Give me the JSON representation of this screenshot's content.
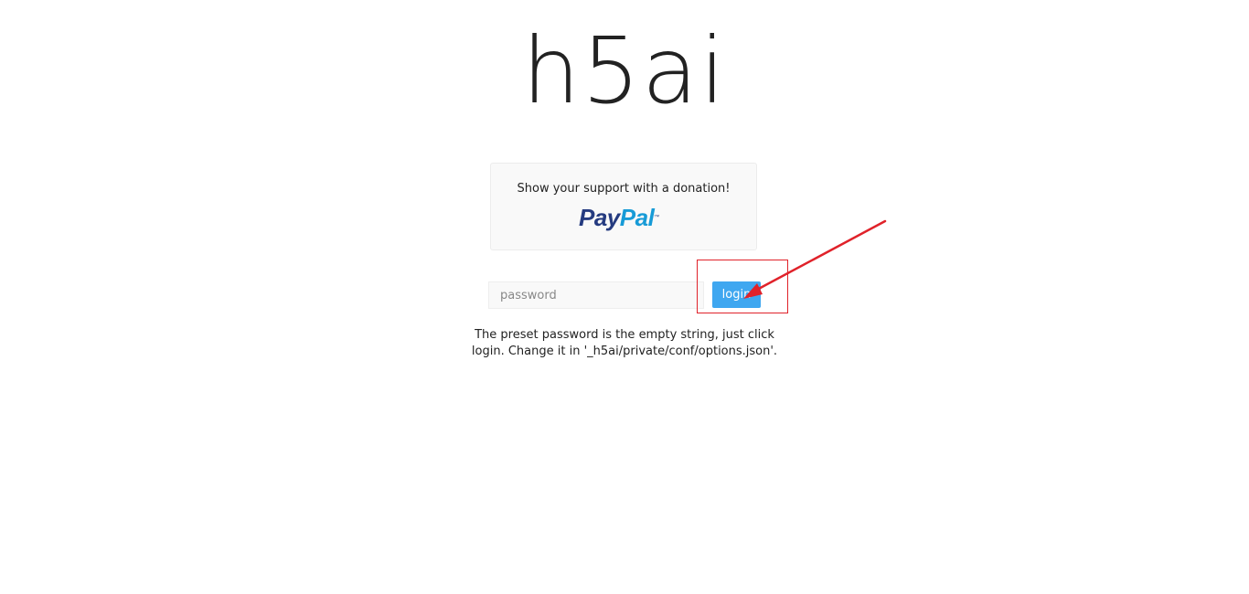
{
  "logo": {
    "text": "h5ai"
  },
  "support": {
    "text": "Show your support with a donation!",
    "paypal_pay": "Pay",
    "paypal_pal": "Pal",
    "paypal_tm": "™"
  },
  "login": {
    "password_placeholder": "password",
    "password_value": "",
    "button_label": "login",
    "hint": "The preset password is the empty string, just click login. Change it in '_h5ai/private/conf/options.json'."
  },
  "annotation": {
    "color": "#e0222a"
  },
  "colors": {
    "accent": "#3fa7f0",
    "paypal_dark": "#253b80",
    "paypal_light": "#179bd7"
  }
}
